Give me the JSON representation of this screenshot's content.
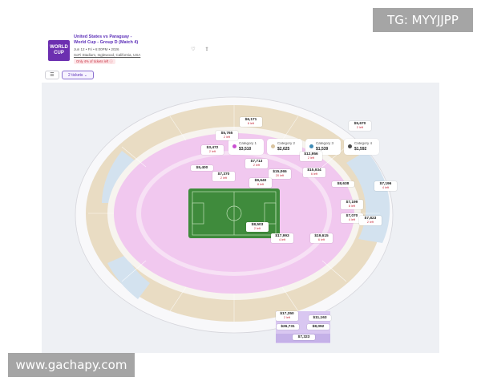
{
  "watermarks": {
    "top_right": "TG: MYYJJPP",
    "bottom_left": "www.gachapy.com"
  },
  "event": {
    "logo_text": "WORLD CUP",
    "title_line1": "United States vs Paraguay -",
    "title_line2": "World Cup - Group D (Match 4)",
    "date_line": "Jun 12 • Fri • 6:00PM • 2026",
    "venue": "SoFi Stadium, Inglewood, California, USA",
    "scarcity_note": "Only 4% of tickets left"
  },
  "icons": {
    "favorite": "heart-icon",
    "share": "share-icon",
    "filters": "sliders-icon",
    "dropdown": "chevron-down-icon"
  },
  "toolbar": {
    "quantity_label": "2 tickets"
  },
  "legend": [
    {
      "name": "Category 1",
      "price": "$3,510",
      "color": "#c94fd1"
    },
    {
      "name": "Category 2",
      "price": "$2,625",
      "color": "#d9c4a0"
    },
    {
      "name": "Category 3",
      "price": "$1,539",
      "color": "#3f8bb5"
    },
    {
      "name": "Category 4",
      "price": "$1,592",
      "color": "#4a4a4a"
    }
  ],
  "colors": {
    "cat1_seats": "#f1c8ef",
    "cat2_seats": "#e9dcc3",
    "cat3_seats": "#d3e2ef",
    "pitch": "#3f8b3c",
    "accent": "#5c2fb8",
    "alert": "#c62a3c"
  },
  "pins": [
    {
      "price": "$6,171",
      "left": "8 left"
    },
    {
      "price": "$5,670",
      "left": "2 left"
    },
    {
      "price": "$5,765",
      "left": "2 left"
    },
    {
      "price": "$3,472",
      "left": "2 left"
    },
    {
      "price": "$12,956",
      "left": "2 left"
    },
    {
      "price": "$7,713",
      "left": "2 left"
    },
    {
      "price": "$5,400",
      "left": ""
    },
    {
      "price": "$7,370",
      "left": "2 left"
    },
    {
      "price": "$15,065",
      "left": "20 left"
    },
    {
      "price": "$15,934",
      "left": "6 left"
    },
    {
      "price": "$9,640",
      "left": "8 left"
    },
    {
      "price": "$8,638",
      "left": ""
    },
    {
      "price": "$7,196",
      "left": "4 left"
    },
    {
      "price": "$7,199",
      "left": "8 left"
    },
    {
      "price": "$7,070",
      "left": "4 left"
    },
    {
      "price": "$7,823",
      "left": "2 left"
    },
    {
      "price": "$8,503",
      "left": "2 left"
    },
    {
      "price": "$17,993",
      "left": "4 left"
    },
    {
      "price": "$19,615",
      "left": "6 left"
    },
    {
      "price": "$17,350",
      "left": "2 left"
    },
    {
      "price": "$11,163",
      "left": ""
    },
    {
      "price": "$26,731",
      "left": ""
    },
    {
      "price": "$8,092",
      "left": ""
    },
    {
      "price": "$7,323",
      "left": ""
    }
  ]
}
